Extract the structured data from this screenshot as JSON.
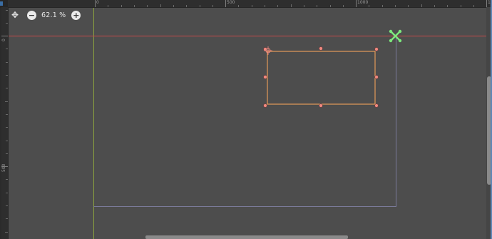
{
  "toolbar": {
    "zoom_out_symbol": "−",
    "zoom_level": "62.1 %",
    "zoom_in_symbol": "+",
    "pan_icon_name": "move-icon"
  },
  "rulers": {
    "top_labels": [
      "0",
      "500",
      "1000",
      "15"
    ],
    "left_labels": [
      "0",
      "500"
    ]
  },
  "colors": {
    "canvas_bg": "#4d4d4d",
    "ruler_bg": "#2e2e2e",
    "x_axis": "#c94a4a",
    "y_axis": "#8aa040",
    "selection_outline": "#e39a5a",
    "handle": "#f08a80",
    "viewport_bounds": "#7a7a9a",
    "pivot": "#7de87d"
  },
  "icons": {
    "pivot": "pivot-cross-icon",
    "pan": "move-icon"
  }
}
